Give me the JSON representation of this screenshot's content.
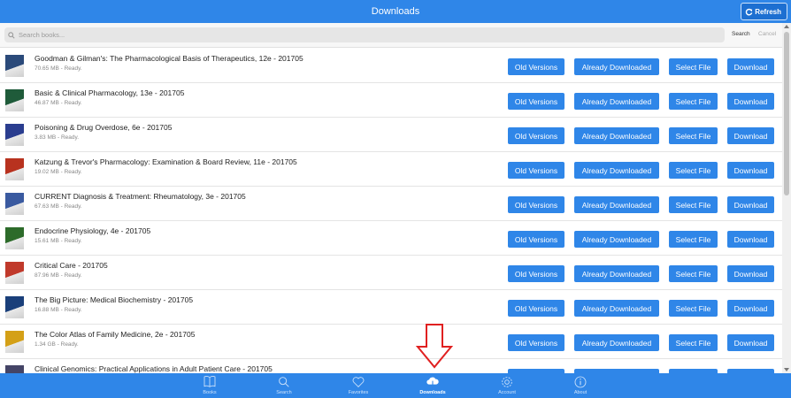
{
  "header": {
    "title": "Downloads",
    "refresh_label": "Refresh",
    "bar_color": "#2f86e8"
  },
  "search": {
    "placeholder": "Search books...",
    "search_label": "Search",
    "cancel_label": "Cancel"
  },
  "buttons": {
    "old_versions": "Old Versions",
    "already_downloaded": "Already Downloaded",
    "select_file": "Select File",
    "download": "Download"
  },
  "books": [
    {
      "title": "Goodman & Gilman's: The Pharmacological Basis of Therapeutics, 12e - 201705",
      "meta": "70.65 MB - Ready.",
      "cover_color": "#2b4a7a"
    },
    {
      "title": "Basic & Clinical Pharmacology, 13e - 201705",
      "meta": "46.87 MB - Ready.",
      "cover_color": "#1f5b3a"
    },
    {
      "title": "Poisoning & Drug Overdose, 6e - 201705",
      "meta": "3.83 MB - Ready.",
      "cover_color": "#2a3d8f"
    },
    {
      "title": "Katzung & Trevor's Pharmacology: Examination & Board Review, 11e - 201705",
      "meta": "19.02 MB - Ready.",
      "cover_color": "#b8321f"
    },
    {
      "title": "CURRENT Diagnosis & Treatment: Rheumatology, 3e - 201705",
      "meta": "67.63 MB - Ready.",
      "cover_color": "#3a5aa0"
    },
    {
      "title": "Endocrine Physiology, 4e - 201705",
      "meta": "15.61 MB - Ready.",
      "cover_color": "#2d6b2a"
    },
    {
      "title": "Critical Care - 201705",
      "meta": "87.96 MB - Ready.",
      "cover_color": "#c0392b"
    },
    {
      "title": "The Big Picture: Medical Biochemistry - 201705",
      "meta": "16.88 MB - Ready.",
      "cover_color": "#1a3f7a"
    },
    {
      "title": "The Color Atlas of Family Medicine, 2e - 201705",
      "meta": "1.34 GB - Ready.",
      "cover_color": "#d4a017"
    },
    {
      "title": "Clinical Genomics: Practical Applications in Adult Patient Care - 201705",
      "meta": "",
      "cover_color": "#444466"
    }
  ],
  "tabs": [
    {
      "label": "Books",
      "icon": "book-icon",
      "active": false
    },
    {
      "label": "Search",
      "icon": "search-icon",
      "active": false
    },
    {
      "label": "Favorites",
      "icon": "heart-icon",
      "active": false
    },
    {
      "label": "Downloads",
      "icon": "cloud-download-icon",
      "active": true
    },
    {
      "label": "Account",
      "icon": "gear-icon",
      "active": false
    },
    {
      "label": "About",
      "icon": "info-icon",
      "active": false
    }
  ],
  "annotation_color": "#e02020"
}
